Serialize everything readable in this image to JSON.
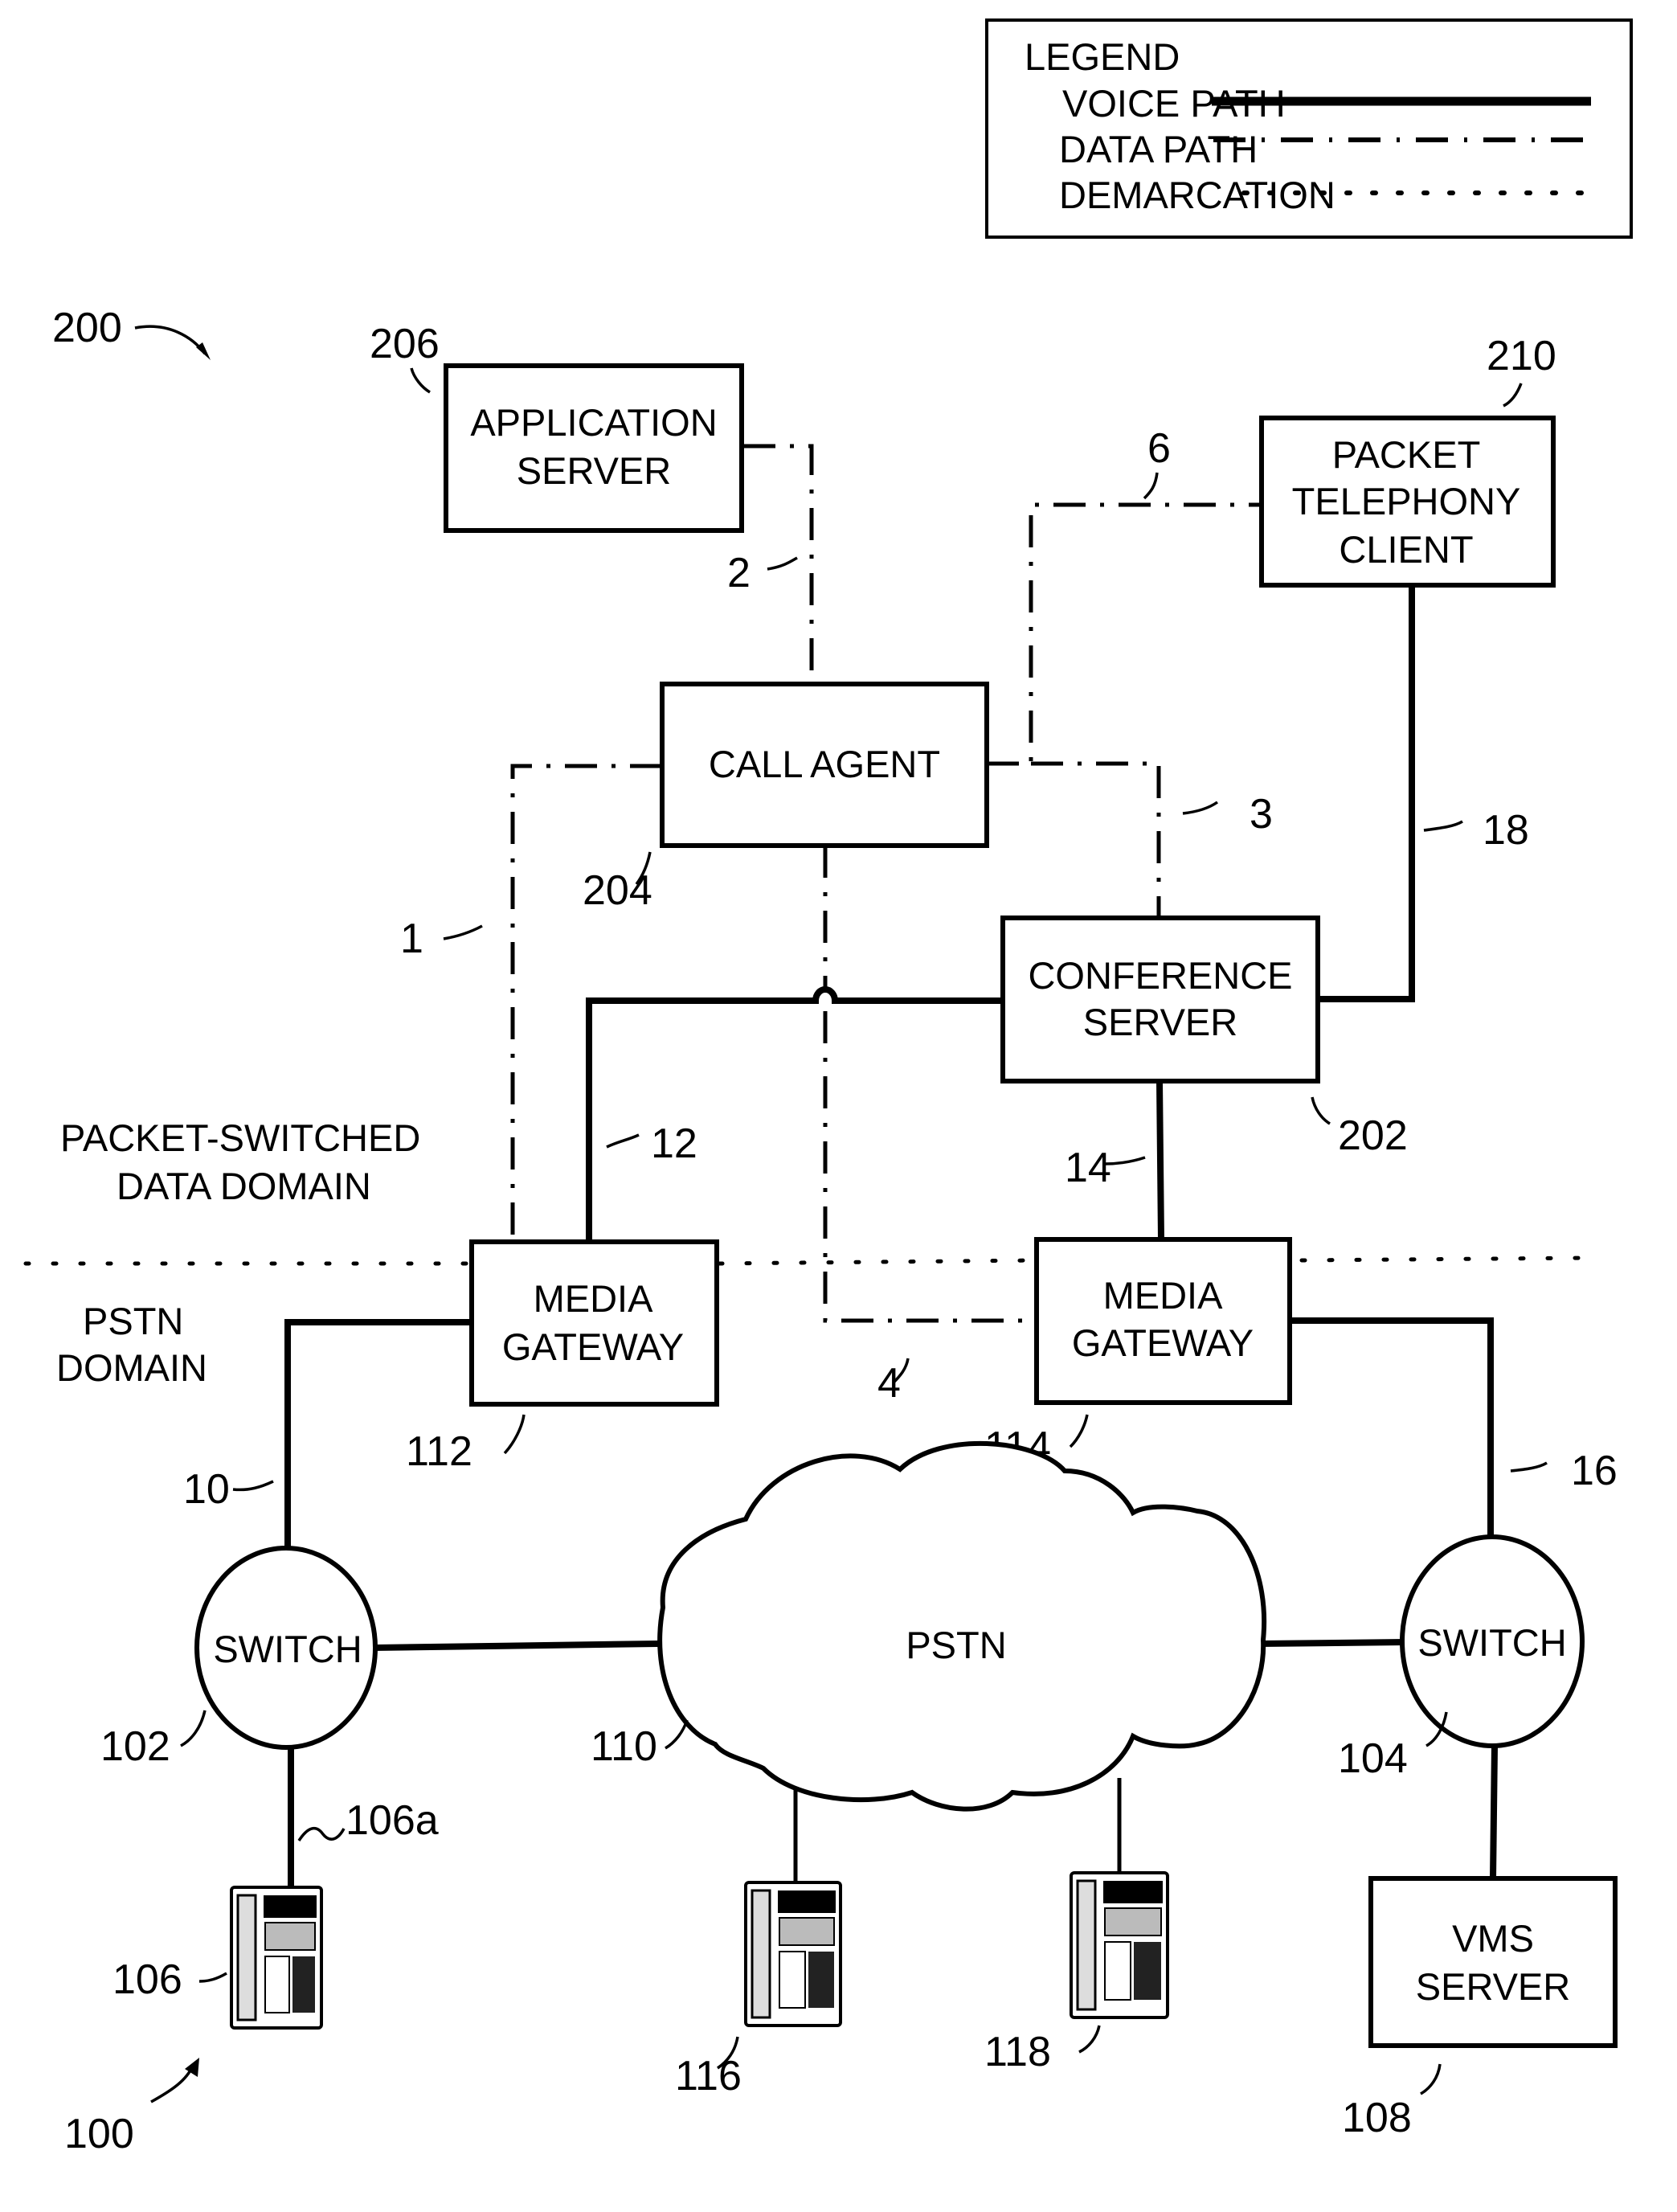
{
  "legend": {
    "title": "LEGEND",
    "items": [
      {
        "label": "VOICE PATH",
        "style": "solid"
      },
      {
        "label": "DATA PATH",
        "style": "dash-dot"
      },
      {
        "label": "DEMARCATION",
        "style": "dotted"
      }
    ]
  },
  "figure_refs": {
    "system_200": "200",
    "system_100": "100"
  },
  "domains": {
    "packet_line1": "PACKET-SWITCHED",
    "packet_line2": "DATA DOMAIN",
    "pstn_line1": "PSTN",
    "pstn_line2": "DOMAIN"
  },
  "nodes": {
    "application_server": {
      "line1": "APPLICATION",
      "line2": "SERVER",
      "ref": "206"
    },
    "packet_telephony_client": {
      "line1": "PACKET",
      "line2": "TELEPHONY",
      "line3": "CLIENT",
      "ref": "210"
    },
    "call_agent": {
      "line1": "CALL AGENT",
      "ref": "204"
    },
    "conference_server": {
      "line1": "CONFERENCE",
      "line2": "SERVER",
      "ref": "202"
    },
    "media_gateway_112": {
      "line1": "MEDIA",
      "line2": "GATEWAY",
      "ref": "112"
    },
    "media_gateway_114": {
      "line1": "MEDIA",
      "line2": "GATEWAY",
      "ref": "114"
    },
    "switch_102": {
      "line1": "SWITCH",
      "ref": "102"
    },
    "switch_104": {
      "line1": "SWITCH",
      "ref": "104"
    },
    "pstn_cloud": {
      "line1": "PSTN",
      "ref": "110"
    },
    "vms_server": {
      "line1": "VMS",
      "line2": "SERVER",
      "ref": "108"
    },
    "phone_106": {
      "ref": "106",
      "link_ref": "106a"
    },
    "phone_116": {
      "ref": "116"
    },
    "phone_118": {
      "ref": "118"
    }
  },
  "links": {
    "data_1": "1",
    "data_2": "2",
    "data_3": "3",
    "data_4": "4",
    "data_6": "6",
    "voice_10": "10",
    "voice_12": "12",
    "voice_14": "14",
    "voice_16": "16",
    "voice_18": "18"
  }
}
